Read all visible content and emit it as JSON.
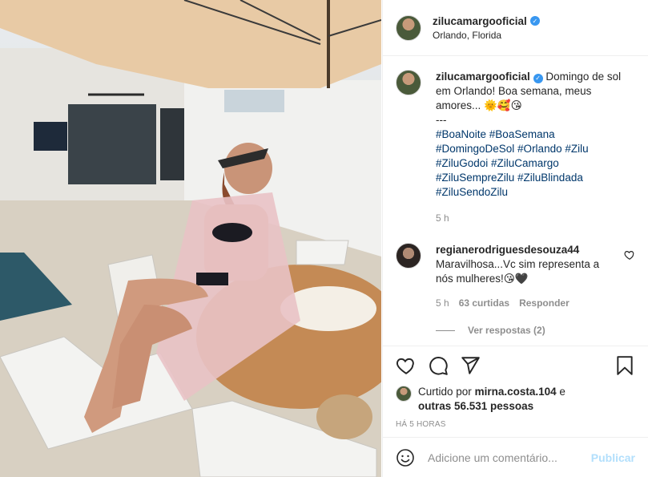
{
  "post": {
    "username": "zilucamargooficial",
    "location": "Orlando, Florida",
    "caption_text": "Domingo de sol em Orlando! Boa semana, meus amores... 🌞🥰😘",
    "caption_separator": "---",
    "hashtags": "#BoaNoite #BoaSemana #DomingoDeSol #Orlando #Zilu #ZiluGodoi #ZiluCamargo #ZiluSempreZilu #ZiluBlindada #ZiluSendoZilu",
    "caption_time": "5 h"
  },
  "comments": [
    {
      "username": "regianerodriguesdesouza44",
      "text": "Maravilhosa...Vc sim representa a nós mulheres!😘🖤",
      "time": "5 h",
      "likes": "63 curtidas",
      "reply_label": "Responder",
      "view_replies": "Ver respostas (2)"
    }
  ],
  "likes": {
    "prefix": "Curtido por",
    "user": "mirna.costa.104",
    "connector": "e",
    "others": "outras 56.531 pessoas"
  },
  "timestamp": "HÁ 5 HORAS",
  "add_comment": {
    "placeholder": "Adicione um comentário...",
    "publish_label": "Publicar"
  },
  "icons": {
    "like": "heart-icon",
    "comment": "comment-icon",
    "share": "share-icon",
    "save": "bookmark-icon",
    "emoji": "emoji-icon",
    "verified": "verified-icon"
  },
  "colors": {
    "accent_blue": "#3897f0",
    "hashtag": "#00376b",
    "muted": "#8e8e8e",
    "publish_disabled": "#b2dffc"
  }
}
